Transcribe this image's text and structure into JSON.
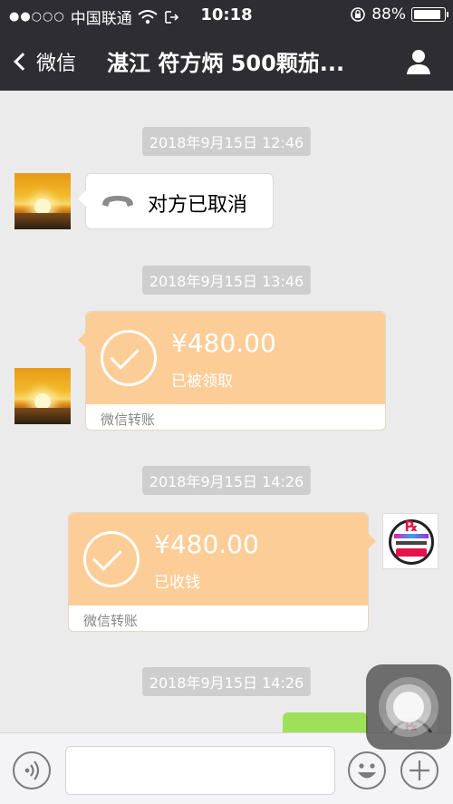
{
  "status_bar": {
    "signal": "●●○○○",
    "carrier": "中国联通",
    "time": "10:18",
    "battery": "88%",
    "battery_level": 0.88
  },
  "nav": {
    "back_label": "微信",
    "title": "湛江 符方炳 500颗茄..."
  },
  "messages": {
    "ts1": "2018年9月15日 12:46",
    "call_text": "对方已取消",
    "ts2": "2018年9月15日 13:46",
    "transfer1": {
      "amount": "¥480.00",
      "status": "已被领取",
      "footer": "微信转账"
    },
    "ts3": "2018年9月15日 14:26",
    "transfer2": {
      "amount": "¥480.00",
      "status": "已收钱",
      "footer": "微信转账"
    },
    "ts4": "2018年9月15日 14:26"
  },
  "colors": {
    "bar": "#2e2e32",
    "transfer": "#fdcd98",
    "chat_bg": "#ebebeb",
    "my_bubble": "#9fe05a"
  },
  "icons": {
    "back": "chevron-left-icon",
    "profile": "person-icon",
    "call": "phone-hangup-icon",
    "check": "check-circle-icon",
    "voice": "voice-icon",
    "emoji": "emoji-icon",
    "plus": "plus-icon"
  }
}
